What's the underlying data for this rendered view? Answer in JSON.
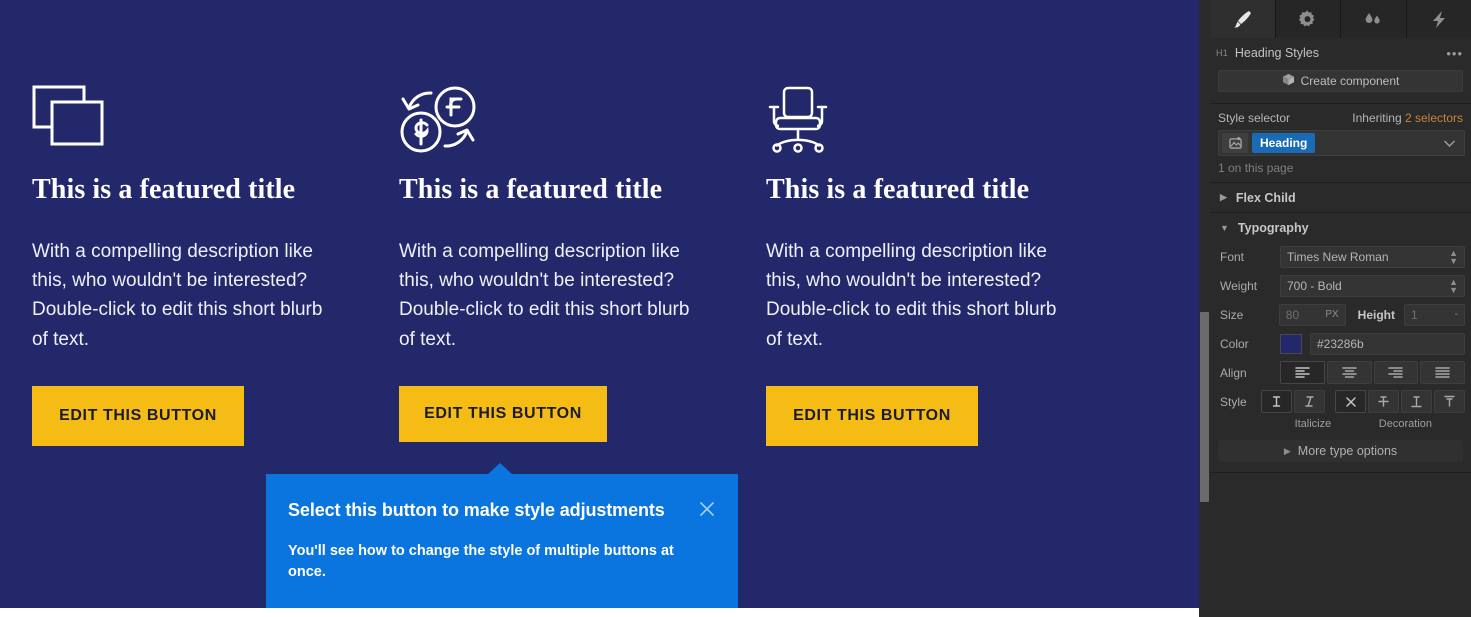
{
  "canvas": {
    "background_color": "#23286b",
    "columns": [
      {
        "icon": "stacked-rectangles-icon",
        "title": "This is a featured title",
        "body": "With a compelling description like this, who wouldn't be interested? Double-click to edit this short blurb of text.",
        "button_label": "EDIT THIS BUTTON"
      },
      {
        "icon": "currency-exchange-icon",
        "title": "This is a featured title",
        "body": "With a compelling description like this, who wouldn't be interested? Double-click to edit this short blurb of text.",
        "button_label": "EDIT THIS BUTTON"
      },
      {
        "icon": "office-chair-icon",
        "title": "This is a featured title",
        "body": "With a compelling description like this, who wouldn't be interested? Double-click to edit this short blurb of text.",
        "button_label": "EDIT THIS BUTTON"
      }
    ],
    "button_color": "#f5bc15"
  },
  "tooltip": {
    "title": "Select this button to make style adjustments",
    "body": "You'll see how to change the style of multiple buttons at once.",
    "close_icon": "close-icon",
    "background_color": "#0a74df"
  },
  "panel": {
    "tabs": [
      {
        "name": "style-tab",
        "icon": "paintbrush-icon",
        "active": true
      },
      {
        "name": "settings-tab",
        "icon": "gear-icon",
        "active": false
      },
      {
        "name": "interactions-tab",
        "icon": "water-drops-icon",
        "active": false
      },
      {
        "name": "effects-tab",
        "icon": "lightning-bolt-icon",
        "active": false
      }
    ],
    "header": {
      "tag": "H1",
      "title": "Heading Styles",
      "menu_icon": "ellipsis-icon"
    },
    "create_component_label": "Create component",
    "style_selector": {
      "label": "Style selector",
      "inheriting_prefix": "Inheriting ",
      "inheriting_count": "2 selectors",
      "inheriting_color": "#c9823a",
      "chip": "Heading",
      "chip_color": "#1a6bb5",
      "on_this_page": "1 on this page"
    },
    "sections": [
      {
        "name": "flex-child",
        "label": "Flex Child",
        "expanded": false
      },
      {
        "name": "typography",
        "label": "Typography",
        "expanded": true
      }
    ],
    "typography": {
      "font_label": "Font",
      "font_value": "Times New Roman",
      "weight_label": "Weight",
      "weight_value": "700 - Bold",
      "size_label": "Size",
      "size_value": "80",
      "size_unit": "PX",
      "height_label": "Height",
      "height_value": "1",
      "height_unit": "-",
      "color_label": "Color",
      "color_value": "#23286b",
      "align_label": "Align",
      "align_options": [
        "align-left-icon",
        "align-center-icon",
        "align-right-icon",
        "align-justify-icon"
      ],
      "align_selected": 0,
      "style_label": "Style",
      "style_options": [
        "upright-icon",
        "italic-icon"
      ],
      "style_selected": 0,
      "decoration_options": [
        "none-icon",
        "strikethrough-icon",
        "underline-icon",
        "overline-icon"
      ],
      "decoration_selected": 0,
      "italicize_sublabel": "Italicize",
      "decoration_sublabel": "Decoration",
      "more_type_options": "More type options"
    }
  }
}
